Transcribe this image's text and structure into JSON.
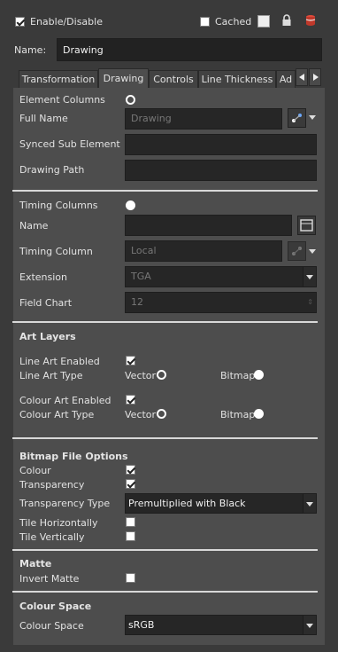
{
  "header": {
    "enable_label": "Enable/Disable",
    "cached_label": "Cached",
    "name_label": "Name:",
    "name_value": "Drawing"
  },
  "tabs": [
    "Transformation",
    "Drawing",
    "Controls",
    "Line Thickness",
    "Ad"
  ],
  "active_tab": "Drawing",
  "element": {
    "element_columns": "Element Columns",
    "full_name": "Full Name",
    "full_name_value": "Drawing",
    "synced_sub_element": "Synced Sub Element",
    "drawing_path": "Drawing Path"
  },
  "timing": {
    "timing_columns": "Timing Columns",
    "name": "Name",
    "timing_column": "Timing Column",
    "timing_column_value": "Local",
    "extension": "Extension",
    "extension_value": "TGA",
    "field_chart": "Field Chart",
    "field_chart_value": "12"
  },
  "art_layers": {
    "title": "Art Layers",
    "line_art_enabled": "Line Art Enabled",
    "line_art_type": "Line Art Type",
    "colour_art_enabled": "Colour Art Enabled",
    "colour_art_type": "Colour Art Type",
    "vector": "Vector",
    "bitmap": "Bitmap"
  },
  "bitmap": {
    "title": "Bitmap File Options",
    "colour": "Colour",
    "transparency": "Transparency",
    "transparency_type": "Transparency Type",
    "transparency_type_value": "Premultiplied with Black",
    "tile_horizontally": "Tile Horizontally",
    "tile_vertically": "Tile Vertically"
  },
  "matte": {
    "title": "Matte",
    "invert_matte": "Invert Matte"
  },
  "colour_space": {
    "title": "Colour Space",
    "label": "Colour Space",
    "value": "sRGB"
  },
  "colors": {
    "background": "#3a3a3a",
    "field": "#262626",
    "lock_red": "#c0392b"
  }
}
